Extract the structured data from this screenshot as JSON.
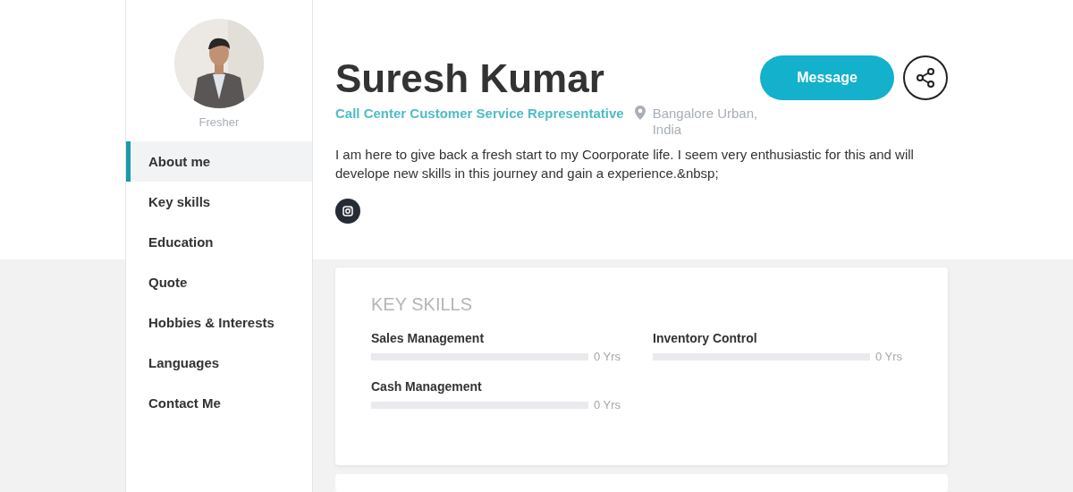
{
  "profile": {
    "level_label": "Fresher"
  },
  "nav": [
    {
      "label": "About me",
      "selected": true
    },
    {
      "label": "Key skills",
      "selected": false
    },
    {
      "label": "Education",
      "selected": false
    },
    {
      "label": "Quote",
      "selected": false
    },
    {
      "label": "Hobbies & Interests",
      "selected": false
    },
    {
      "label": "Languages",
      "selected": false
    },
    {
      "label": "Contact Me",
      "selected": false
    }
  ],
  "header": {
    "name": "Suresh Kumar",
    "job_title": "Call Center Customer Service Representative",
    "location": "Bangalore Urban, India",
    "about": "I am here to give back a fresh start to my Coorporate life. I seem very enthusiastic for this and will develope new skills in this journey and gain a experience.&nbsp;",
    "message_button": "Message"
  },
  "key_skills": {
    "title": "KEY SKILLS",
    "skills": [
      {
        "name": "Sales Management",
        "level": 0,
        "reading": "0 Yrs"
      },
      {
        "name": "Inventory Control",
        "level": 0,
        "reading": "0 Yrs"
      },
      {
        "name": "Cash Management",
        "level": 0,
        "reading": "0 Yrs"
      }
    ]
  }
}
